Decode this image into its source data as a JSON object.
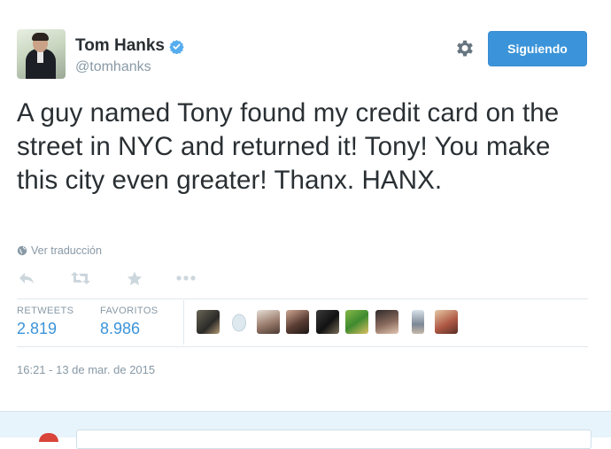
{
  "author": {
    "name": "Tom Hanks",
    "handle": "@tomhanks",
    "verified_icon": "verified-badge-icon",
    "avatar_icon": "profile-photo"
  },
  "header": {
    "settings_icon": "gear-icon",
    "follow_button_label": "Siguiendo"
  },
  "tweet": {
    "text": "A guy named Tony found my credit card on the street in NYC and returned it!  Tony! You make this city even greater!  Thanx. HANX.",
    "translate_label": "Ver traducción",
    "timestamp": "16:21 - 13 de mar. de 2015"
  },
  "actions": [
    {
      "name": "reply",
      "icon": "reply-icon"
    },
    {
      "name": "retweet",
      "icon": "retweet-icon"
    },
    {
      "name": "favorite",
      "icon": "star-icon"
    },
    {
      "name": "more",
      "icon": "more-dots-icon"
    }
  ],
  "stats": {
    "retweets_label": "RETWEETS",
    "retweets_value": "2.819",
    "favorites_label": "FAVORITOS",
    "favorites_value": "8.986"
  },
  "favoriters_count": 10,
  "colors": {
    "accent": "#3b94d9",
    "muted": "#8899a6",
    "text": "#292f33",
    "border": "#e1e8ed",
    "verified": "#55acee"
  }
}
